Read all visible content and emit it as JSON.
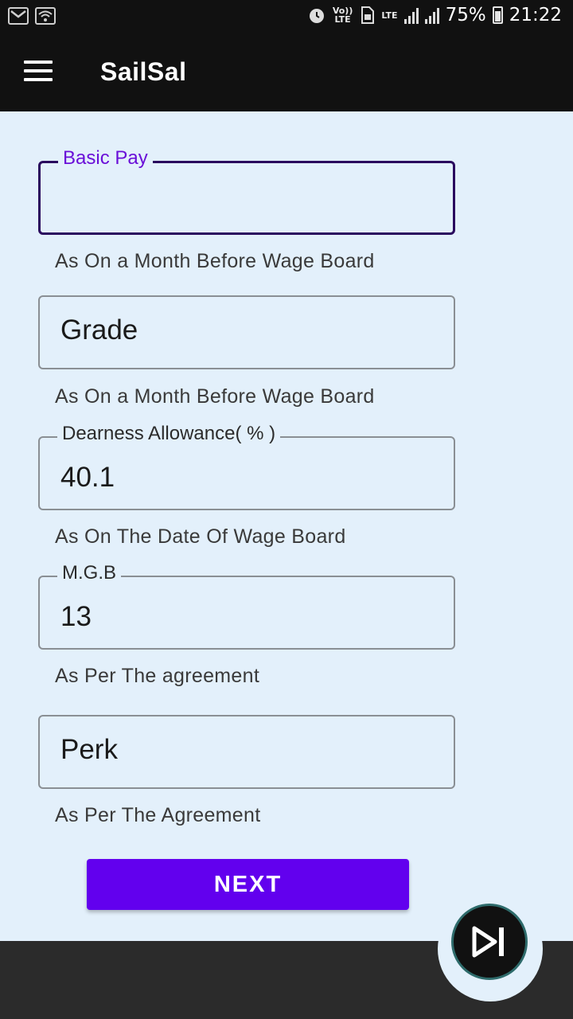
{
  "status_bar": {
    "battery": "75%",
    "time": "21:22",
    "volte_label": "Vo))\nLTE",
    "lte_label": "LTE",
    "icons": [
      "gmail-icon",
      "wifi-icon",
      "alarm-icon",
      "volte-icon",
      "sim-icon",
      "lte-icon",
      "signal-icon",
      "signal-icon",
      "battery-icon"
    ]
  },
  "app_bar": {
    "title": "SailSal",
    "menu_icon": "hamburger-menu-icon"
  },
  "form": {
    "basic_pay": {
      "label": "Basic Pay",
      "value": "",
      "hint": "As On a Month Before Wage Board"
    },
    "grade": {
      "placeholder": "Grade",
      "hint": "As On a Month Before Wage Board"
    },
    "dearness_allowance": {
      "label": "Dearness Allowance( % )",
      "value": "40.1",
      "hint": "As On The Date Of Wage Board"
    },
    "mgb": {
      "label": "M.G.B",
      "value": "13",
      "hint": "As Per The agreement"
    },
    "perk": {
      "placeholder": "Perk",
      "hint": "As Per The Agreement"
    }
  },
  "next_button": {
    "label": "NEXT"
  },
  "fab": {
    "icon": "skip-next-icon"
  },
  "colors": {
    "background": "#e3f0fb",
    "app_bar": "#111111",
    "accent": "#6200ee",
    "focused_label": "#6a0fd8",
    "bottom_bar": "#2b2b2b"
  }
}
